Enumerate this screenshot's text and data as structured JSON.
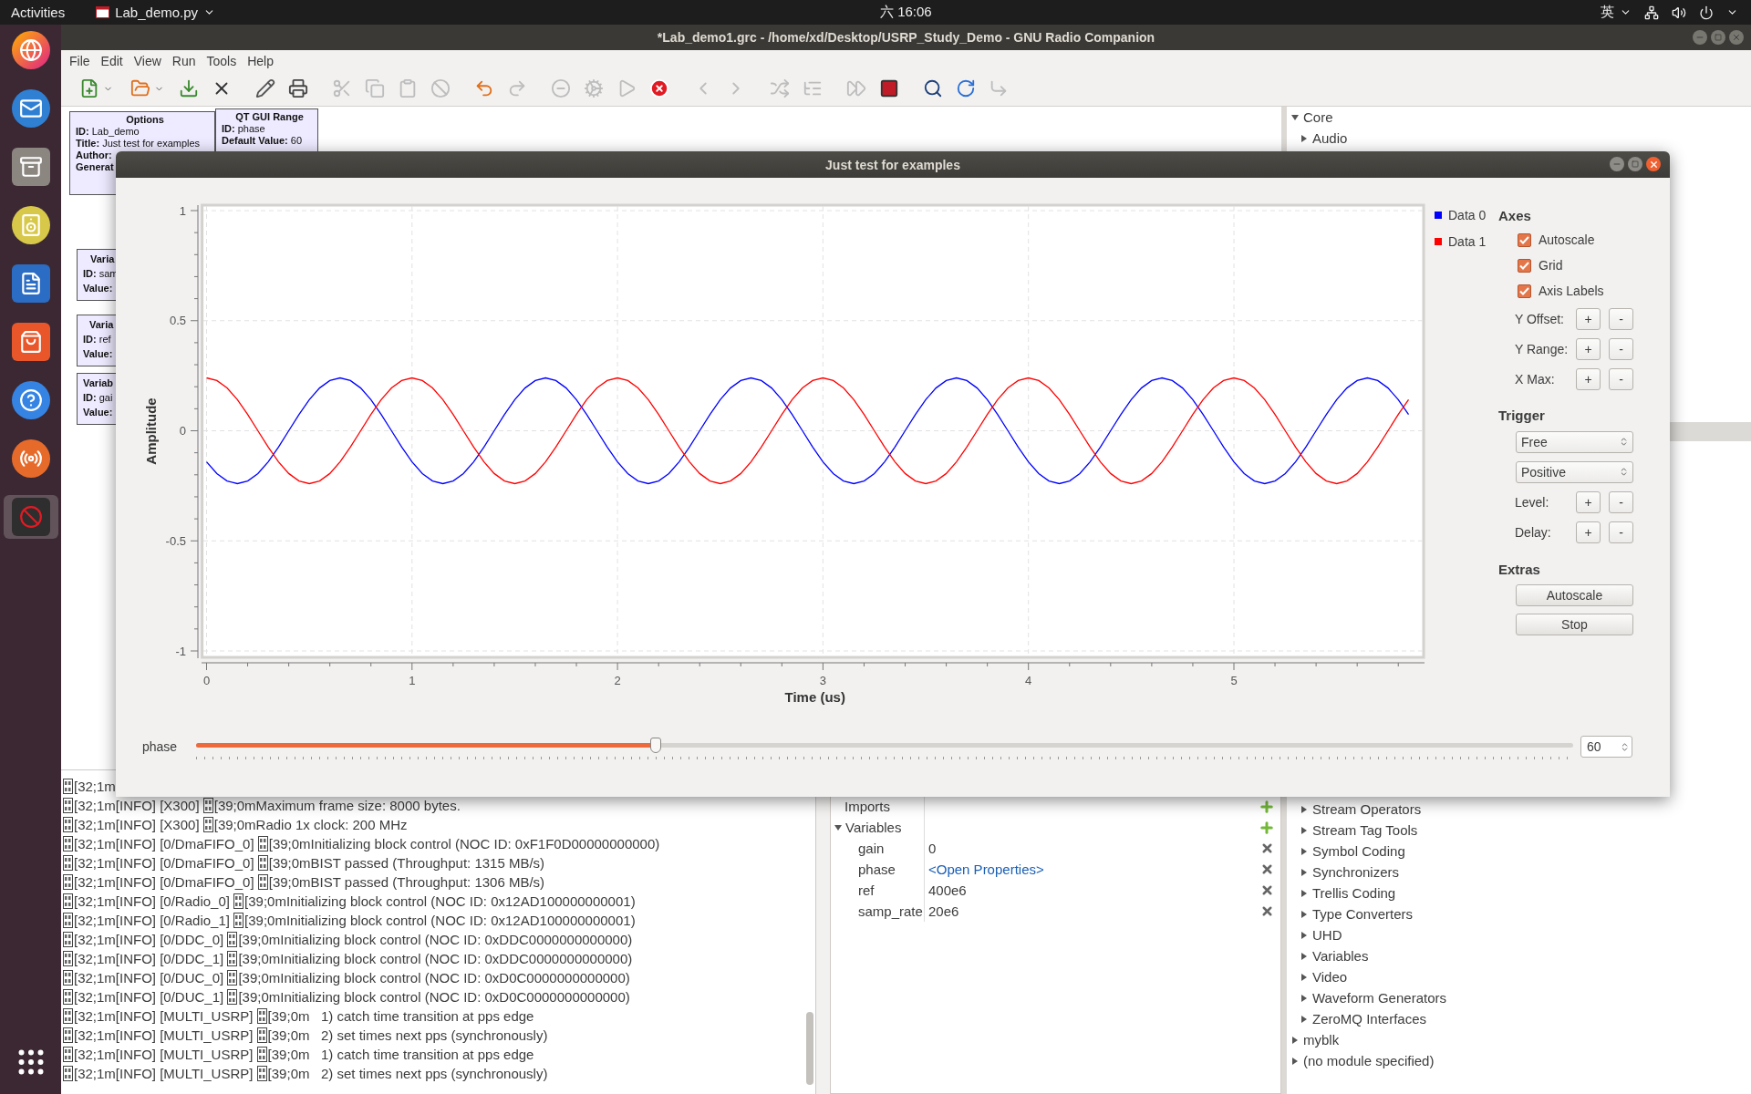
{
  "top_bar": {
    "activities": "Activities",
    "app_menu": "Lab_demo.py",
    "clock": "六 16:06",
    "input_method": "英"
  },
  "dock": [
    {
      "selected": false
    },
    {
      "selected": false
    },
    {
      "selected": false
    },
    {
      "selected": false
    },
    {
      "selected": false
    },
    {
      "selected": false
    },
    {
      "selected": false
    },
    {
      "selected": false
    },
    {
      "selected": true
    }
  ],
  "window": {
    "title": "*Lab_demo1.grc - /home/xd/Desktop/USRP_Study_Demo - GNU Radio Companion",
    "menu": [
      "File",
      "Edit",
      "View",
      "Run",
      "Tools",
      "Help"
    ],
    "toolbar": [
      {
        "kind": "button",
        "disabled": false
      },
      {
        "kind": "button",
        "disabled": false
      },
      {
        "kind": "button",
        "disabled": false
      },
      {
        "kind": "button",
        "disabled": false
      },
      {
        "kind": "separator"
      },
      {
        "kind": "button",
        "disabled": false
      },
      {
        "kind": "button",
        "disabled": false
      },
      {
        "kind": "separator"
      },
      {
        "kind": "button",
        "disabled": true
      },
      {
        "kind": "button",
        "disabled": true
      },
      {
        "kind": "button",
        "disabled": true
      },
      {
        "kind": "button",
        "disabled": true
      },
      {
        "kind": "separator"
      },
      {
        "kind": "button",
        "disabled": false
      },
      {
        "kind": "button",
        "disabled": true
      },
      {
        "kind": "separator"
      },
      {
        "kind": "button",
        "disabled": true
      },
      {
        "kind": "button",
        "disabled": true
      },
      {
        "kind": "button",
        "disabled": true
      },
      {
        "kind": "button",
        "disabled": false
      },
      {
        "kind": "separator"
      },
      {
        "kind": "button",
        "disabled": true
      },
      {
        "kind": "button",
        "disabled": true
      },
      {
        "kind": "separator"
      },
      {
        "kind": "button",
        "disabled": true
      },
      {
        "kind": "button",
        "disabled": true
      },
      {
        "kind": "separator"
      },
      {
        "kind": "button",
        "disabled": true
      },
      {
        "kind": "button",
        "disabled": false
      },
      {
        "kind": "separator"
      },
      {
        "kind": "button",
        "disabled": false
      },
      {
        "kind": "button",
        "disabled": false
      },
      {
        "kind": "button",
        "disabled": true
      }
    ]
  },
  "canvas_blocks": [
    {
      "title": "Options",
      "params": [
        {
          "key": "ID:",
          "value": "Lab_demo"
        },
        {
          "key": "Title:",
          "value": "Just test for examples"
        },
        {
          "key": "Author:"
        },
        {
          "key": "Generat"
        }
      ]
    },
    {
      "title": "QT GUI Range",
      "params": [
        {
          "key": "ID:",
          "value": "phase"
        },
        {
          "key": "Default Value:",
          "value": "60"
        }
      ]
    },
    {
      "title": "Varia",
      "params": [
        {
          "key": "ID:",
          "value": "sam"
        },
        {
          "key": "Value:"
        }
      ]
    },
    {
      "title": "Varia",
      "params": [
        {
          "key": "ID:",
          "value": "ref"
        },
        {
          "key": "Value:"
        }
      ]
    },
    {
      "title": "Variab",
      "params": [
        {
          "key": "ID:",
          "value": "gai"
        },
        {
          "key": "Value:"
        }
      ]
    }
  ],
  "library_tree": [
    {
      "label": "Core",
      "expanded": true,
      "children": [
        {
          "label": "Audio",
          "expanded": false
        },
        {
          "label": "Stream Operators",
          "expanded": false
        },
        {
          "label": "Stream Tag Tools",
          "expanded": false
        },
        {
          "label": "Symbol Coding",
          "expanded": false
        },
        {
          "label": "Synchronizers",
          "expanded": false
        },
        {
          "label": "Trellis Coding",
          "expanded": false
        },
        {
          "label": "Type Converters",
          "expanded": false
        },
        {
          "label": "UHD",
          "expanded": false
        },
        {
          "label": "Variables",
          "expanded": false
        },
        {
          "label": "Video",
          "expanded": false
        },
        {
          "label": "Waveform Generators",
          "expanded": false
        },
        {
          "label": "ZeroMQ Interfaces",
          "expanded": false
        }
      ]
    },
    {
      "label": "myblk",
      "expanded": false
    },
    {
      "label": "(no module specified)",
      "expanded": false
    }
  ],
  "console_log": [
    [
      "[32;1m"
    ],
    [
      "[32;1m[INFO] [X300] ",
      "[39;0mMaximum frame size: 8000 bytes."
    ],
    [
      "[32;1m[INFO] [X300] ",
      "[39;0mRadio 1x clock: 200 MHz"
    ],
    [
      "[32;1m[INFO] [0/DmaFIFO_0] ",
      "[39;0mInitializing block control (NOC ID: 0xF1F0D00000000000)"
    ],
    [
      "[32;1m[INFO] [0/DmaFIFO_0] ",
      "[39;0mBIST passed (Throughput: 1315 MB/s)"
    ],
    [
      "[32;1m[INFO] [0/DmaFIFO_0] ",
      "[39;0mBIST passed (Throughput: 1306 MB/s)"
    ],
    [
      "[32;1m[INFO] [0/Radio_0] ",
      "[39;0mInitializing block control (NOC ID: 0x12AD100000000001)"
    ],
    [
      "[32;1m[INFO] [0/Radio_1] ",
      "[39;0mInitializing block control (NOC ID: 0x12AD100000000001)"
    ],
    [
      "[32;1m[INFO] [0/DDC_0] ",
      "[39;0mInitializing block control (NOC ID: 0xDDC0000000000000)"
    ],
    [
      "[32;1m[INFO] [0/DDC_1] ",
      "[39;0mInitializing block control (NOC ID: 0xDDC0000000000000)"
    ],
    [
      "[32;1m[INFO] [0/DUC_0] ",
      "[39;0mInitializing block control (NOC ID: 0xD0C0000000000000)"
    ],
    [
      "[32;1m[INFO] [0/DUC_1] ",
      "[39;0mInitializing block control (NOC ID: 0xD0C0000000000000)"
    ],
    [
      "[32;1m[INFO] [MULTI_USRP] ",
      "[39;0m   1) catch time transition at pps edge"
    ],
    [
      "[32;1m[INFO] [MULTI_USRP] ",
      "[39;0m   2) set times next pps (synchronously)"
    ],
    [
      "[32;1m[INFO] [MULTI_USRP] ",
      "[39;0m   1) catch time transition at pps edge"
    ],
    [
      "[32;1m[INFO] [MULTI_USRP] ",
      "[39;0m   2) set times next pps (synchronously)"
    ]
  ],
  "variables_panel": [
    {
      "label": "Imports"
    },
    {
      "label": "Variables",
      "expanded": true,
      "children": [
        {
          "name": "gain",
          "value": "0",
          "kind": "text"
        },
        {
          "name": "phase",
          "value": "<Open Properties>",
          "kind": "link"
        },
        {
          "name": "ref",
          "value": "400e6",
          "kind": "text"
        },
        {
          "name": "samp_rate",
          "value": "20e6",
          "kind": "text"
        }
      ]
    }
  ],
  "plot_window": {
    "title": "Just test for examples",
    "chart_data": {
      "type": "line",
      "grid": true,
      "xlabel": "Time (us)",
      "ylabel": "Amplitude",
      "xlim": [
        0,
        5.9
      ],
      "ylim": [
        -1,
        1
      ],
      "xticks": [
        0,
        1,
        2,
        3,
        4,
        5
      ],
      "yticks": [
        -1,
        -0.5,
        0,
        0.5,
        1
      ],
      "x": [
        0,
        0.05,
        0.1,
        0.15,
        0.2,
        0.25,
        0.3,
        0.35,
        0.4,
        0.45,
        0.5,
        0.55,
        0.6,
        0.65,
        0.7,
        0.75,
        0.8,
        0.85,
        0.9,
        0.95,
        1,
        1.05,
        1.1,
        1.15,
        1.2,
        1.25,
        1.3,
        1.35,
        1.4,
        1.45,
        1.5,
        1.55,
        1.6,
        1.65,
        1.7,
        1.75,
        1.8,
        1.85,
        1.9,
        1.95,
        2,
        2.05,
        2.1,
        2.15,
        2.2,
        2.25,
        2.3,
        2.35,
        2.4,
        2.45,
        2.5,
        2.55,
        2.6,
        2.65,
        2.7,
        2.75,
        2.8,
        2.85,
        2.9,
        2.95,
        3,
        3.05,
        3.1,
        3.15,
        3.2,
        3.25,
        3.3,
        3.35,
        3.4,
        3.45,
        3.5,
        3.55,
        3.6,
        3.65,
        3.7,
        3.75,
        3.8,
        3.85,
        3.9,
        3.95,
        4,
        4.05,
        4.1,
        4.15,
        4.2,
        4.25,
        4.3,
        4.35,
        4.4,
        4.45,
        4.5,
        4.55,
        4.6,
        4.65,
        4.7,
        4.75,
        4.8,
        4.85,
        4.9,
        4.95,
        5,
        5.05,
        5.1,
        5.15,
        5.2,
        5.25,
        5.3,
        5.35,
        5.4,
        5.45,
        5.5,
        5.55,
        5.6,
        5.65,
        5.7,
        5.75,
        5.8,
        5.85
      ],
      "series": [
        {
          "name": "Data 0",
          "color": "#0000ff",
          "values": [
            -0.141,
            -0.194,
            -0.228,
            -0.24,
            -0.228,
            -0.194,
            -0.141,
            -0.074,
            0,
            0.074,
            0.141,
            0.194,
            0.228,
            0.24,
            0.228,
            0.194,
            0.141,
            0.074,
            0,
            -0.074,
            -0.141,
            -0.194,
            -0.228,
            -0.24,
            -0.228,
            -0.194,
            -0.141,
            -0.074,
            0,
            0.074,
            0.141,
            0.194,
            0.228,
            0.24,
            0.228,
            0.194,
            0.141,
            0.074,
            0,
            -0.074,
            -0.141,
            -0.194,
            -0.228,
            -0.24,
            -0.228,
            -0.194,
            -0.141,
            -0.074,
            0,
            0.074,
            0.141,
            0.194,
            0.228,
            0.24,
            0.228,
            0.194,
            0.141,
            0.074,
            0,
            -0.074,
            -0.141,
            -0.194,
            -0.228,
            -0.24,
            -0.228,
            -0.194,
            -0.141,
            -0.074,
            0,
            0.074,
            0.141,
            0.194,
            0.228,
            0.24,
            0.228,
            0.194,
            0.141,
            0.074,
            0,
            -0.074,
            -0.141,
            -0.194,
            -0.228,
            -0.24,
            -0.228,
            -0.194,
            -0.141,
            -0.074,
            0,
            0.074,
            0.141,
            0.194,
            0.228,
            0.24,
            0.228,
            0.194,
            0.141,
            0.074,
            0,
            -0.074,
            -0.141,
            -0.194,
            -0.228,
            -0.24,
            -0.228,
            -0.194,
            -0.141,
            -0.074,
            0,
            0.074,
            0.141,
            0.194,
            0.228,
            0.24,
            0.228,
            0.194,
            0.141,
            0.074
          ]
        },
        {
          "name": "Data 1",
          "color": "#ff0000",
          "values": [
            0.24,
            0.228,
            0.194,
            0.141,
            0.074,
            0,
            -0.074,
            -0.141,
            -0.194,
            -0.228,
            -0.24,
            -0.228,
            -0.194,
            -0.141,
            -0.074,
            0,
            0.074,
            0.141,
            0.194,
            0.228,
            0.24,
            0.228,
            0.194,
            0.141,
            0.074,
            0,
            -0.074,
            -0.141,
            -0.194,
            -0.228,
            -0.24,
            -0.228,
            -0.194,
            -0.141,
            -0.074,
            0,
            0.074,
            0.141,
            0.194,
            0.228,
            0.24,
            0.228,
            0.194,
            0.141,
            0.074,
            0,
            -0.074,
            -0.141,
            -0.194,
            -0.228,
            -0.24,
            -0.228,
            -0.194,
            -0.141,
            -0.074,
            0,
            0.074,
            0.141,
            0.194,
            0.228,
            0.24,
            0.228,
            0.194,
            0.141,
            0.074,
            0,
            -0.074,
            -0.141,
            -0.194,
            -0.228,
            -0.24,
            -0.228,
            -0.194,
            -0.141,
            -0.074,
            0,
            0.074,
            0.141,
            0.194,
            0.228,
            0.24,
            0.228,
            0.194,
            0.141,
            0.074,
            0,
            -0.074,
            -0.141,
            -0.194,
            -0.228,
            -0.24,
            -0.228,
            -0.194,
            -0.141,
            -0.074,
            0,
            0.074,
            0.141,
            0.194,
            0.228,
            0.24,
            0.228,
            0.194,
            0.141,
            0.074,
            0,
            -0.074,
            -0.141,
            -0.194,
            -0.228,
            -0.24,
            -0.228,
            -0.194,
            -0.141,
            -0.074,
            0,
            0.074,
            0.141
          ]
        }
      ]
    },
    "axes": {
      "title": "Axes",
      "checks": [
        {
          "label": "Autoscale",
          "checked": true
        },
        {
          "label": "Grid",
          "checked": true
        },
        {
          "label": "Axis Labels",
          "checked": true
        }
      ],
      "steppers": [
        {
          "label": "Y Offset:",
          "plus": "+",
          "minus": "-"
        },
        {
          "label": "Y Range:",
          "plus": "+",
          "minus": "-"
        },
        {
          "label": "X Max:",
          "plus": "+",
          "minus": "-"
        }
      ]
    },
    "trigger": {
      "title": "Trigger",
      "selects": [
        "Free",
        "Positive"
      ],
      "steppers": [
        {
          "label": "Level:",
          "plus": "+",
          "minus": "-"
        },
        {
          "label": "Delay:",
          "plus": "+",
          "minus": "-"
        }
      ]
    },
    "extras": {
      "title": "Extras",
      "buttons": [
        "Autoscale",
        "Stop"
      ]
    },
    "slider": {
      "label": "phase",
      "level": 0.334,
      "value": "60"
    }
  }
}
